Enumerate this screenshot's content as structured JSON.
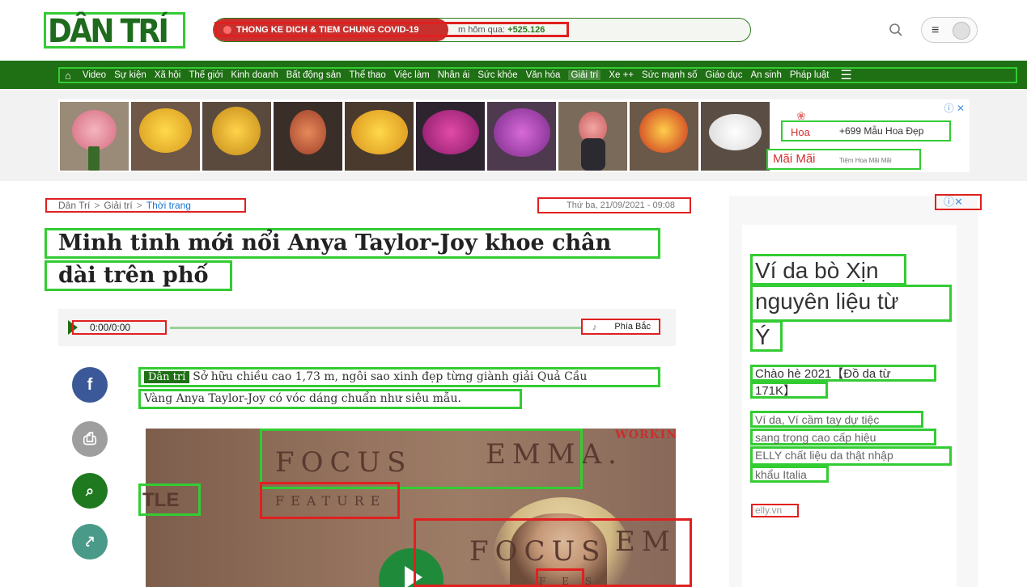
{
  "header": {
    "logo": "DÂN TRÍ",
    "covid_label": "THONG KE DICH & TIEM CHUNG COVID-19",
    "covid_stat_prefix": "m hôm qua: ",
    "covid_stat_value": "+525.126",
    "menu_glyph": "≡"
  },
  "nav": {
    "items": [
      "Video",
      "Sự kiện",
      "Xã hội",
      "Thế giới",
      "Kinh doanh",
      "Bất động sản",
      "Thể thao",
      "Việc làm",
      "Nhân ái",
      "Sức khỏe",
      "Văn hóa",
      "Giải trí",
      "Xe ++",
      "Sức mạnh số",
      "Giáo dục",
      "An sinh",
      "Pháp luật"
    ],
    "active": "Giải trí"
  },
  "ad_banner": {
    "info": "ⓘ ✕",
    "brand_hoa": "Hoa",
    "count_text": "+699 Mẫu Hoa Đẹp",
    "brand_mai": "Mãi Mãi",
    "shop_name": "Tiệm Hoa Mãi Mãi"
  },
  "breadcrumb": [
    "Dân Trí",
    "Giải trí",
    "Thời trang"
  ],
  "date": "Thứ ba, 21/09/2021 - 09:08",
  "article": {
    "title_line1": "Minh tinh mới nổi Anya Taylor-Joy khoe chân",
    "title_line2": "dài trên phố",
    "audio_time": "0:00/0:00",
    "audio_voice": "Phía Bắc",
    "lead_tag": "Dân trí",
    "lead_line1": "Sở hữu chiều cao 1,73 m, ngôi sao xinh đẹp từng giành giải Quả Cầu",
    "lead_line2": "Vàng Anya Taylor-Joy có vóc dáng chuẩn như siêu mẫu.",
    "video_text": {
      "focus": "FOCUS",
      "emma": "EMMA.",
      "feature": "FEATURE",
      "tle": "TLE",
      "focus2": "FOCUS",
      "emm": "EMM",
      "fes": "F E S",
      "working": "WORKING"
    }
  },
  "social": {
    "facebook": "f",
    "print": "⎙",
    "comment": "⌕",
    "share": "⤤"
  },
  "side_ad": {
    "info": "ⓘ✕",
    "headline_1": "Ví da bò Xịn",
    "headline_2": "nguyên liệu từ",
    "headline_3": "Ý",
    "sub_1": "Chào hè 2021【Đồ da từ",
    "sub_2": "171K】",
    "desc_1": "Ví da, Ví cầm tay dự tiệc",
    "desc_2": "sang trọng cao cấp hiệu",
    "desc_3": "ELLY chất liệu da thật nhập",
    "desc_4": "khẩu Italia",
    "url": "elly.vn"
  }
}
